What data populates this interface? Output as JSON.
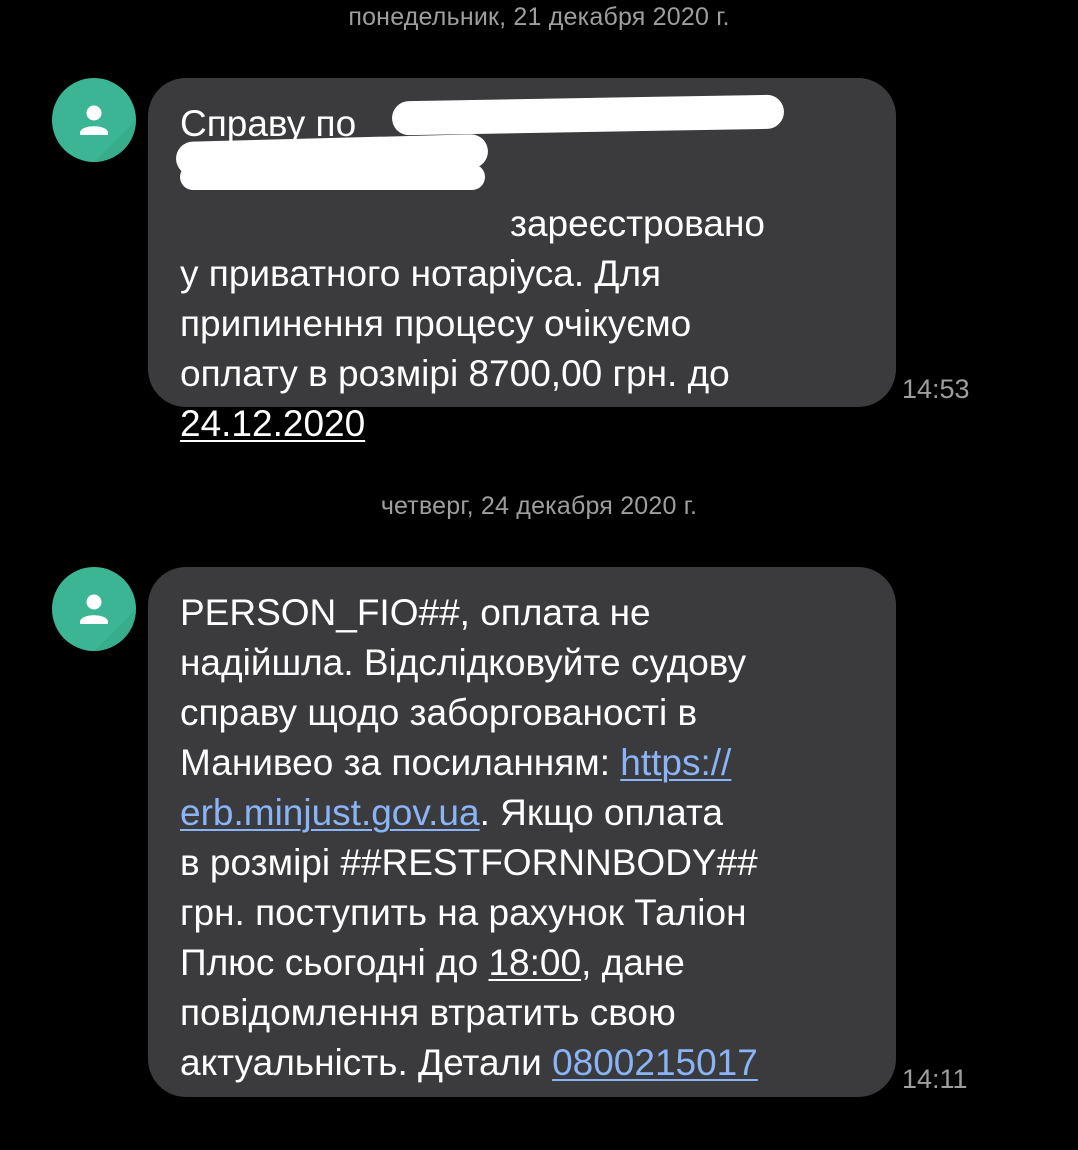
{
  "conversation": {
    "messages": [
      {
        "date": "понедельник, 21 декабря 2020 г.",
        "lines": [
          "Справу по",
          "",
          "зареєстровано",
          "у приватного нотаріуса. Для",
          "припинення процесу очікуємо",
          "оплату в розмірі 8700,00 грн. до"
        ],
        "date_link": "24.12.2020",
        "time": "14:53"
      },
      {
        "date": "четверг, 24 декабря 2020 г.",
        "lines": [
          "PERSON_FIO##, оплата не",
          "надійшла. Відслідковуйте судову",
          "справу щодо заборгованості в",
          "Манивео за посиланням: ",
          "",
          "в розмірі ##RESTFORNNBODY##",
          "грн. поступить на рахунок Таліон",
          "Плюс сьогодні до ",
          "повідомлення втратить свою",
          "актуальність. Детали "
        ],
        "link_part1": "https://",
        "link_part2": "erb.minjust.gov.ua",
        "after_link": ". Якщо оплата",
        "deadline_time": "18:00",
        "after_time": ", дане",
        "phone": "0800215017",
        "time": "14:11"
      }
    ]
  },
  "colors": {
    "background": "#000000",
    "bubble": "#3b3b3d",
    "avatar": "#3bb593",
    "link": "#8ab4f8",
    "meta_text": "#9e9e9e"
  },
  "icons": {
    "avatar": "person-icon"
  }
}
